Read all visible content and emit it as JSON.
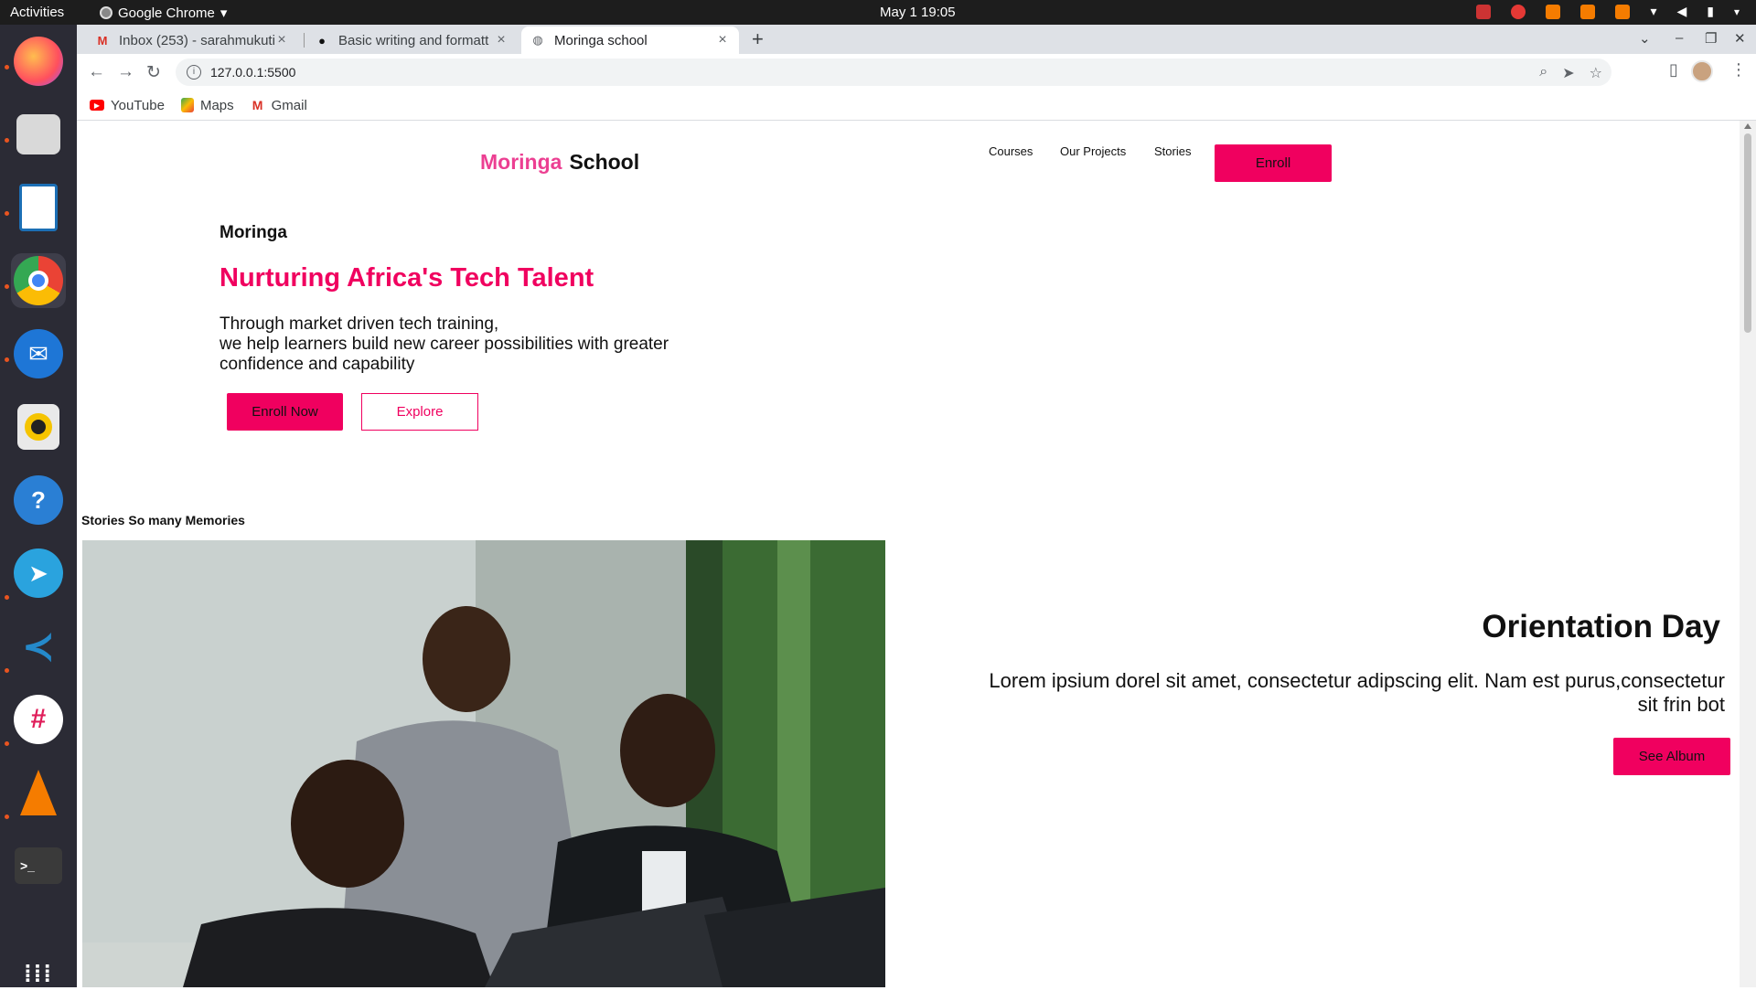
{
  "os": {
    "activities": "Activities",
    "app_name": "Google Chrome",
    "clock": "May 1  19:05"
  },
  "browser": {
    "tabs": [
      {
        "title": "Inbox (253) - sarahmukuti",
        "favicon": "gmail-icon"
      },
      {
        "title": "Basic writing and formatt",
        "favicon": "github-icon"
      },
      {
        "title": "Moringa school",
        "favicon": "globe-icon",
        "active": true
      }
    ],
    "url": "127.0.0.1:5500",
    "bookmarks": [
      {
        "label": "YouTube",
        "icon": "youtube-icon"
      },
      {
        "label": "Maps",
        "icon": "maps-icon"
      },
      {
        "label": "Gmail",
        "icon": "gmail-icon"
      }
    ]
  },
  "page": {
    "logo": {
      "part1": "Moringa",
      "part2": "School"
    },
    "nav": [
      "Courses",
      "Our Projects",
      "Stories"
    ],
    "enroll": "Enroll",
    "hero": {
      "eyebrow": "Moringa",
      "title": "Nurturing Africa's Tech Talent",
      "lines": [
        "Through market driven tech training,",
        "we help learners build new career possibilities with greater",
        "confidence and capability"
      ],
      "primary_cta": "Enroll Now",
      "secondary_cta": "Explore"
    },
    "stories_heading": "Stories So many Memories",
    "orientation": {
      "title": "Orientation Day",
      "text": "Lorem ipsium dorel sit amet, consectetur adipscing elit. Nam est purus,consectetur sit frin bot",
      "cta": "See Album"
    }
  },
  "colors": {
    "accent": "#f0005f",
    "dock": "#2b2b35",
    "topbar": "#1d1d1d"
  }
}
